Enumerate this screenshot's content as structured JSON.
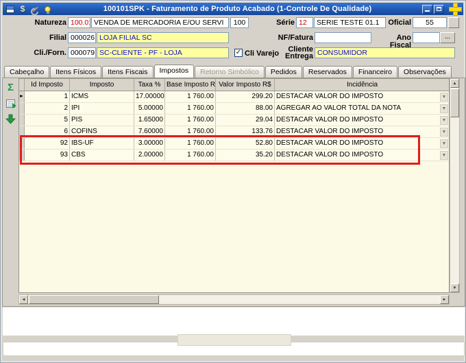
{
  "window": {
    "title": "100101SPK - Faturamento de Produto Acabado (1-Controle De Qualidade)"
  },
  "form": {
    "natureza_label": "Natureza",
    "natureza_code": "100.01",
    "natureza_desc": "VENDA DE MERCADORIA E/OU SERVI",
    "natureza_num": "100",
    "serie_label": "Série",
    "serie_code": "12",
    "serie_desc": "SERIE TESTE 01.1",
    "oficial_label": "Oficial",
    "oficial_value": "55",
    "filial_label": "Filial",
    "filial_code": "000026",
    "filial_desc": "LOJA FILIAL SC",
    "nf_fatura_label": "NF/Fatura",
    "nf_fatura_value": "",
    "ano_fiscal_label": "Ano Fiscal",
    "ano_fiscal_value": "",
    "cli_forn_label": "Cli./Forn.",
    "cli_forn_code": "000079",
    "cli_forn_desc": "SC-CLIENTE - PF - LOJA",
    "cli_varejo_label": "Cli Varejo",
    "cli_varejo_checked": true,
    "cliente_entrega_label": "Cliente Entrega",
    "cliente_entrega_value": "CONSUMIDOR"
  },
  "tabs": [
    {
      "id": "cabecalho",
      "label": "Cabeçalho"
    },
    {
      "id": "itens-fisicos",
      "label": "Itens Físicos"
    },
    {
      "id": "itens-fiscais",
      "label": "Itens Fiscais"
    },
    {
      "id": "impostos",
      "label": "Impostos",
      "active": true
    },
    {
      "id": "retorno-simbolico",
      "label": "Retorno Simbólico",
      "disabled": true
    },
    {
      "id": "pedidos",
      "label": "Pedidos"
    },
    {
      "id": "reservados",
      "label": "Reservados"
    },
    {
      "id": "financeiro",
      "label": "Financeiro"
    },
    {
      "id": "observacoes",
      "label": "Observações"
    }
  ],
  "table": {
    "columns": [
      "Id Imposto",
      "Imposto",
      "Taxa %",
      "Base Imposto R$",
      "Valor Imposto R$",
      "Incidência"
    ],
    "rows": [
      {
        "selected": true,
        "id": "1",
        "imposto": "ICMS",
        "taxa": "17.00000",
        "base": "1 760.00",
        "valor": "299.20",
        "incidencia": "DESTACAR VALOR DO IMPOSTO"
      },
      {
        "id": "2",
        "imposto": "IPI",
        "taxa": "5.00000",
        "base": "1 760.00",
        "valor": "88.00",
        "incidencia": "AGREGAR AO VALOR TOTAL DA NOTA"
      },
      {
        "id": "5",
        "imposto": "PIS",
        "taxa": "1.65000",
        "base": "1 760.00",
        "valor": "29.04",
        "incidencia": "DESTACAR VALOR DO IMPOSTO"
      },
      {
        "id": "6",
        "imposto": "COFINS",
        "taxa": "7.60000",
        "base": "1 760.00",
        "valor": "133.76",
        "incidencia": "DESTACAR VALOR DO IMPOSTO"
      },
      {
        "id": "92",
        "imposto": "IBS-UF",
        "taxa": "3.00000",
        "base": "1 760.00",
        "valor": "52.80",
        "incidencia": "DESTACAR VALOR DO IMPOSTO",
        "highlighted": true
      },
      {
        "id": "93",
        "imposto": "CBS",
        "taxa": "2.00000",
        "base": "1 760.00",
        "valor": "35.20",
        "incidencia": "DESTACAR VALOR DO IMPOSTO",
        "highlighted": true
      }
    ]
  },
  "icons": {
    "sigma": "Σ",
    "dollar": "$",
    "up": "▲",
    "down": "▼",
    "left": "◄",
    "right": "►",
    "pointer": "►",
    "check": "✓",
    "chevron": "▼",
    "dots": "..."
  },
  "colors": {
    "titlebar_blue": "#1e56b0",
    "highlight_border": "#e01b1b",
    "field_yellow": "#ffffa0",
    "field_text_blue": "#0b0bcf",
    "code_red": "#c80000",
    "grid_row_bg": "#fdfbe9"
  }
}
